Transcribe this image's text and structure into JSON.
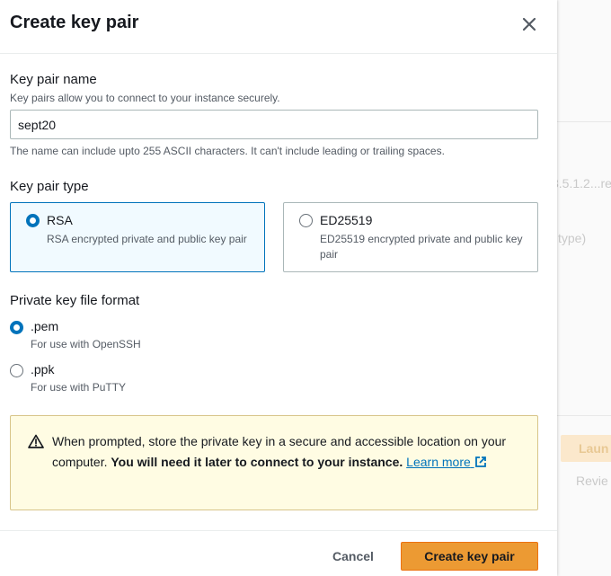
{
  "modal": {
    "title": "Create key pair",
    "close_icon": "close-icon"
  },
  "key_name": {
    "label": "Key pair name",
    "description": "Key pairs allow you to connect to your instance securely.",
    "value": "sept20",
    "constraint": "The name can include upto 255 ASCII characters. It can't include leading or trailing spaces."
  },
  "key_type": {
    "label": "Key pair type",
    "options": [
      {
        "title": "RSA",
        "description": "RSA encrypted private and public key pair",
        "selected": true
      },
      {
        "title": "ED25519",
        "description": "ED25519 encrypted private and public key pair",
        "selected": false
      }
    ]
  },
  "file_format": {
    "label": "Private key file format",
    "options": [
      {
        "title": ".pem",
        "description": "For use with OpenSSH",
        "selected": true
      },
      {
        "title": ".ppk",
        "description": "For use with PuTTY",
        "selected": false
      }
    ]
  },
  "alert": {
    "icon": "warning-icon",
    "text": "When prompted, store the private key in a secure and accessible location on your computer.",
    "bold_text": "You will need it later to connect to your instance.",
    "link_text": "Learn more",
    "link_icon": "external-link-icon"
  },
  "footer": {
    "cancel_label": "Cancel",
    "create_label": "Create key pair"
  },
  "background": {
    "text1": "3.5.1.2...re",
    "text2": "type)",
    "button": "Laun",
    "text3": "Revie"
  },
  "colors": {
    "primary_button": "#ec9a33",
    "selected_border": "#0073bb",
    "selected_bg": "#f1faff",
    "alert_bg": "#fffce3",
    "alert_border": "#d8c58a",
    "link": "#0073bb"
  }
}
